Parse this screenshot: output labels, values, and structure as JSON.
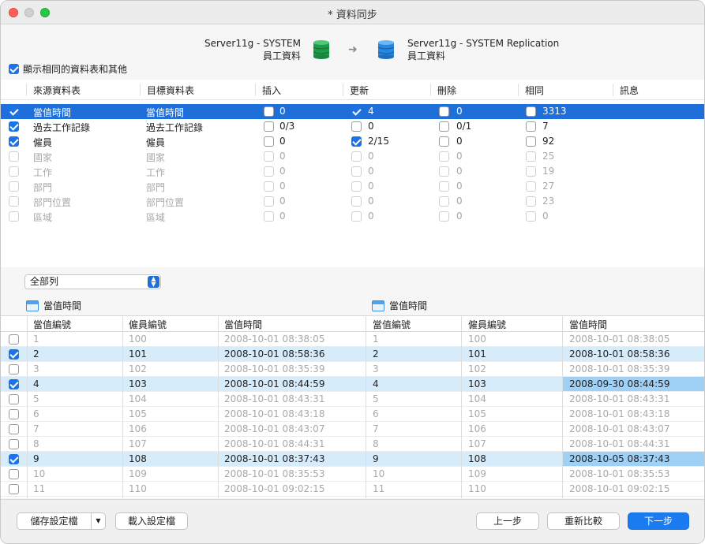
{
  "window": {
    "title": "* 資料同步"
  },
  "source": {
    "server": "Server11g - SYSTEM",
    "schema": "員工資料"
  },
  "target": {
    "server": "Server11g - SYSTEM Replication",
    "schema": "員工資料"
  },
  "show_same_label": "顯示相同的資料表和其他",
  "top_table": {
    "headers": [
      "來源資料表",
      "目標資料表",
      "插入",
      "更新",
      "刪除",
      "相同",
      "訊息"
    ],
    "rows": [
      {
        "checked": true,
        "enabled": true,
        "src": "當值時間",
        "dst": "當值時間",
        "ins_checked": false,
        "ins": "0",
        "upd_checked": true,
        "upd": "4",
        "del_checked": false,
        "del": "0",
        "same_checked": false,
        "same": "3313"
      },
      {
        "checked": true,
        "enabled": true,
        "src": "過去工作記錄",
        "dst": "過去工作記錄",
        "ins_checked": false,
        "ins": "0/3",
        "upd_checked": false,
        "upd": "0",
        "del_checked": false,
        "del": "0/1",
        "same_checked": false,
        "same": "7"
      },
      {
        "checked": true,
        "enabled": true,
        "src": "僱員",
        "dst": "僱員",
        "ins_checked": false,
        "ins": "0",
        "upd_checked": true,
        "upd": "2/15",
        "del_checked": false,
        "del": "0",
        "same_checked": false,
        "same": "92"
      },
      {
        "checked": false,
        "enabled": false,
        "src": "國家",
        "dst": "國家",
        "ins_checked": false,
        "ins": "0",
        "upd_checked": false,
        "upd": "0",
        "del_checked": false,
        "del": "0",
        "same_checked": false,
        "same": "25"
      },
      {
        "checked": false,
        "enabled": false,
        "src": "工作",
        "dst": "工作",
        "ins_checked": false,
        "ins": "0",
        "upd_checked": false,
        "upd": "0",
        "del_checked": false,
        "del": "0",
        "same_checked": false,
        "same": "19"
      },
      {
        "checked": false,
        "enabled": false,
        "src": "部門",
        "dst": "部門",
        "ins_checked": false,
        "ins": "0",
        "upd_checked": false,
        "upd": "0",
        "del_checked": false,
        "del": "0",
        "same_checked": false,
        "same": "27"
      },
      {
        "checked": false,
        "enabled": false,
        "src": "部門位置",
        "dst": "部門位置",
        "ins_checked": false,
        "ins": "0",
        "upd_checked": false,
        "upd": "0",
        "del_checked": false,
        "del": "0",
        "same_checked": false,
        "same": "23"
      },
      {
        "checked": false,
        "enabled": false,
        "src": "區域",
        "dst": "區域",
        "ins_checked": false,
        "ins": "0",
        "upd_checked": false,
        "upd": "0",
        "del_checked": false,
        "del": "0",
        "same_checked": false,
        "same": "0"
      }
    ]
  },
  "filter": {
    "selected": "全部列"
  },
  "left_table_title": "當值時間",
  "right_table_title": "當值時間",
  "bottom_table": {
    "left_headers": [
      "當值編號",
      "僱員編號",
      "當值時間"
    ],
    "right_headers": [
      "當值編號",
      "僱員編號",
      "當值時間"
    ],
    "rows": [
      {
        "checked": false,
        "highlight": false,
        "l": [
          "1",
          "100",
          "2008-10-01 08:38:05"
        ],
        "r": [
          "1",
          "100",
          "2008-10-01 08:38:05"
        ],
        "diff": false
      },
      {
        "checked": true,
        "highlight": true,
        "l": [
          "2",
          "101",
          "2008-10-01 08:58:36"
        ],
        "r": [
          "2",
          "101",
          "2008-10-01 08:58:36"
        ],
        "diff": false
      },
      {
        "checked": false,
        "highlight": false,
        "l": [
          "3",
          "102",
          "2008-10-01 08:35:39"
        ],
        "r": [
          "3",
          "102",
          "2008-10-01 08:35:39"
        ],
        "diff": false
      },
      {
        "checked": true,
        "highlight": true,
        "l": [
          "4",
          "103",
          "2008-10-01 08:44:59"
        ],
        "r": [
          "4",
          "103",
          "2008-09-30 08:44:59"
        ],
        "diff": true
      },
      {
        "checked": false,
        "highlight": false,
        "l": [
          "5",
          "104",
          "2008-10-01 08:43:31"
        ],
        "r": [
          "5",
          "104",
          "2008-10-01 08:43:31"
        ],
        "diff": false
      },
      {
        "checked": false,
        "highlight": false,
        "l": [
          "6",
          "105",
          "2008-10-01 08:43:18"
        ],
        "r": [
          "6",
          "105",
          "2008-10-01 08:43:18"
        ],
        "diff": false
      },
      {
        "checked": false,
        "highlight": false,
        "l": [
          "7",
          "106",
          "2008-10-01 08:43:07"
        ],
        "r": [
          "7",
          "106",
          "2008-10-01 08:43:07"
        ],
        "diff": false
      },
      {
        "checked": false,
        "highlight": false,
        "l": [
          "8",
          "107",
          "2008-10-01 08:44:31"
        ],
        "r": [
          "8",
          "107",
          "2008-10-01 08:44:31"
        ],
        "diff": false
      },
      {
        "checked": true,
        "highlight": true,
        "l": [
          "9",
          "108",
          "2008-10-01 08:37:43"
        ],
        "r": [
          "9",
          "108",
          "2008-10-05 08:37:43"
        ],
        "diff": true
      },
      {
        "checked": false,
        "highlight": false,
        "l": [
          "10",
          "109",
          "2008-10-01 08:35:53"
        ],
        "r": [
          "10",
          "109",
          "2008-10-01 08:35:53"
        ],
        "diff": false
      },
      {
        "checked": false,
        "highlight": false,
        "l": [
          "11",
          "110",
          "2008-10-01 09:02:15"
        ],
        "r": [
          "11",
          "110",
          "2008-10-01 09:02:15"
        ],
        "diff": false
      }
    ]
  },
  "buttons": {
    "save_profile": "儲存設定檔",
    "load_profile": "載入設定檔",
    "back": "上一步",
    "recompare": "重新比較",
    "next": "下一步"
  }
}
